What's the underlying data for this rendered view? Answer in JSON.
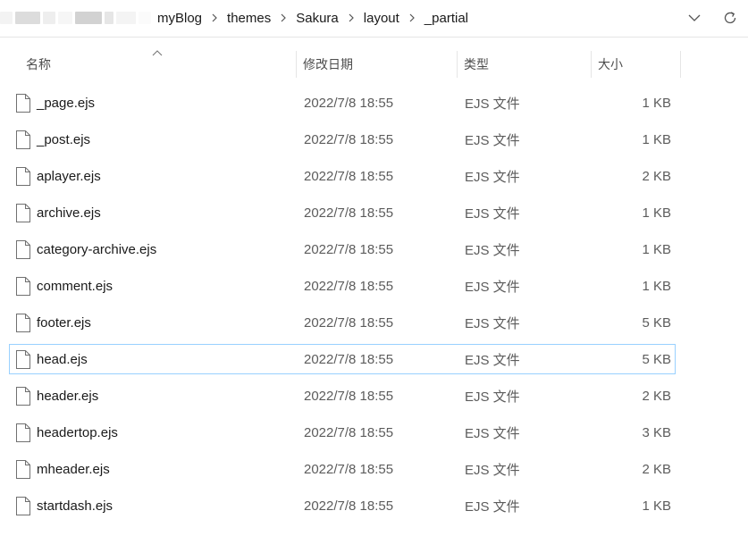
{
  "breadcrumb": {
    "items": [
      "myBlog",
      "themes",
      "Sakura",
      "layout",
      "_partial"
    ]
  },
  "columns": {
    "name": "名称",
    "date": "修改日期",
    "type": "类型",
    "size": "大小"
  },
  "files": [
    {
      "name": "_page.ejs",
      "date": "2022/7/8 18:55",
      "type": "EJS 文件",
      "size": "1 KB"
    },
    {
      "name": "_post.ejs",
      "date": "2022/7/8 18:55",
      "type": "EJS 文件",
      "size": "1 KB"
    },
    {
      "name": "aplayer.ejs",
      "date": "2022/7/8 18:55",
      "type": "EJS 文件",
      "size": "2 KB"
    },
    {
      "name": "archive.ejs",
      "date": "2022/7/8 18:55",
      "type": "EJS 文件",
      "size": "1 KB"
    },
    {
      "name": "category-archive.ejs",
      "date": "2022/7/8 18:55",
      "type": "EJS 文件",
      "size": "1 KB"
    },
    {
      "name": "comment.ejs",
      "date": "2022/7/8 18:55",
      "type": "EJS 文件",
      "size": "1 KB"
    },
    {
      "name": "footer.ejs",
      "date": "2022/7/8 18:55",
      "type": "EJS 文件",
      "size": "5 KB"
    },
    {
      "name": "head.ejs",
      "date": "2022/7/8 18:55",
      "type": "EJS 文件",
      "size": "5 KB"
    },
    {
      "name": "header.ejs",
      "date": "2022/7/8 18:55",
      "type": "EJS 文件",
      "size": "2 KB"
    },
    {
      "name": "headertop.ejs",
      "date": "2022/7/8 18:55",
      "type": "EJS 文件",
      "size": "3 KB"
    },
    {
      "name": "mheader.ejs",
      "date": "2022/7/8 18:55",
      "type": "EJS 文件",
      "size": "2 KB"
    },
    {
      "name": "startdash.ejs",
      "date": "2022/7/8 18:55",
      "type": "EJS 文件",
      "size": "1 KB"
    }
  ],
  "focused_file": "head.ejs",
  "sort": {
    "column": "name",
    "direction": "ascending"
  },
  "icons": {
    "breadcrumb_separator": "chevron-right-icon",
    "history": "chevron-down-icon",
    "refresh": "refresh-icon",
    "file": "file-icon",
    "sort": "sort-up-icon"
  },
  "colors": {
    "focus_border": "#99d1ff",
    "divider": "#e5e5e5",
    "secondary_text": "#5c5c5c"
  }
}
